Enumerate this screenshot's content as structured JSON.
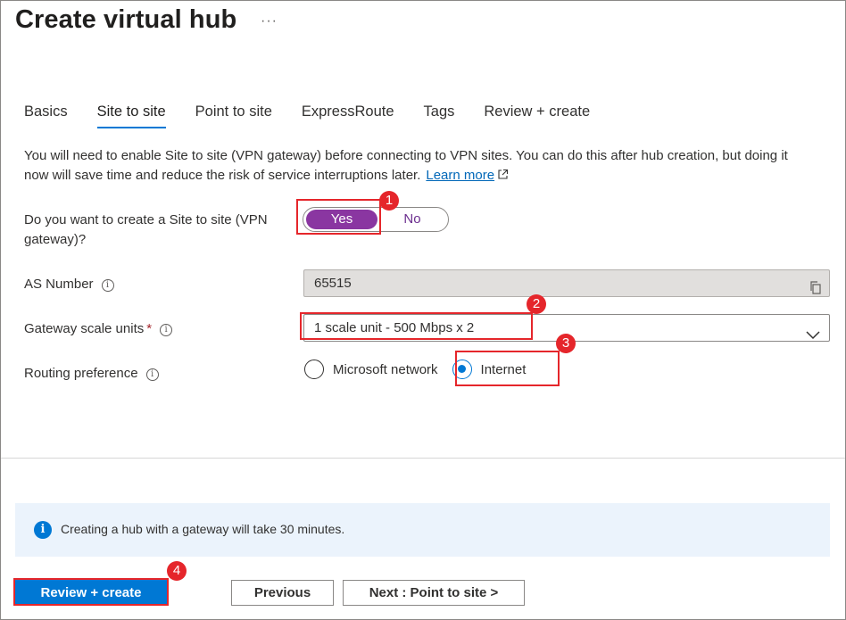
{
  "header": {
    "title": "Create virtual hub",
    "more_label": "···"
  },
  "tabs": [
    {
      "label": "Basics",
      "active": false
    },
    {
      "label": "Site to site",
      "active": true
    },
    {
      "label": "Point to site",
      "active": false
    },
    {
      "label": "ExpressRoute",
      "active": false
    },
    {
      "label": "Tags",
      "active": false
    },
    {
      "label": "Review + create",
      "active": false
    }
  ],
  "description": {
    "text": "You will need to enable Site to site (VPN gateway) before connecting to VPN sites. You can do this after hub creation, but doing it now will save time and reduce the risk of service interruptions later.",
    "link_label": "Learn more"
  },
  "form": {
    "vpn_question_label": "Do you want to create a Site to site (VPN gateway)?",
    "toggle_yes": "Yes",
    "toggle_no": "No",
    "toggle_selected": "Yes",
    "as_number_label": "AS Number",
    "as_number_value": "65515",
    "gateway_scale_label": "Gateway scale units",
    "required_mark": "*",
    "gateway_scale_value": "1 scale unit - 500 Mbps x 2",
    "routing_label": "Routing preference",
    "routing_options": [
      "Microsoft network",
      "Internet"
    ],
    "routing_selected": "Internet"
  },
  "info_bar": {
    "text": "Creating a hub with a gateway will take 30 minutes."
  },
  "footer": {
    "review_create": "Review + create",
    "previous": "Previous",
    "next": "Next : Point to site >"
  },
  "annotations": {
    "badges": [
      "1",
      "2",
      "3",
      "4"
    ]
  },
  "colors": {
    "accent": "#0078d4",
    "toggle_selected": "#8a36a1",
    "highlight": "#e5262b",
    "info_bar_bg": "#ebf3fc"
  },
  "icons": [
    "ellipsis-icon",
    "external-link-icon",
    "info-icon",
    "copy-icon",
    "chevron-down-icon",
    "info-circle-icon"
  ]
}
